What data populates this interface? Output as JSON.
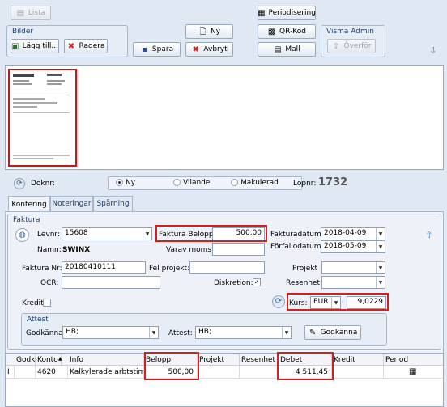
{
  "toolbar": {
    "lista": "Lista",
    "bilder_group": "Bilder",
    "lagg_till": "Lägg till...",
    "radera": "Radera",
    "ny": "Ny",
    "spara": "Spara",
    "avbryt": "Avbryt",
    "periodisering": "Periodisering",
    "qr_kod": "QR-Kod",
    "mall": "Mall",
    "visma_group": "Visma Admin",
    "overfor": "Överför"
  },
  "status": {
    "doknr_label": "Doknr:",
    "radio_ny": "Ny",
    "radio_vilande": "Vilande",
    "radio_makulerad": "Makulerad",
    "lopnr_label": "Löpnr:",
    "lopnr_value": "1732"
  },
  "tabs": [
    "Kontering",
    "Noteringar",
    "Spårning"
  ],
  "faktura": {
    "group_title": "Faktura",
    "levnr_label": "Levnr:",
    "levnr_value": "15608",
    "namn_label": "Namn:",
    "namn_value": "SWINX",
    "belopp_label": "Faktura Belopp:",
    "belopp_value": "500,00",
    "varav_moms_label": "Varav moms:",
    "fakturadatum_label": "Fakturadatum:",
    "fakturadatum_value": "2018-04-09",
    "forfallodatum_label": "Förfallodatum:",
    "forfallodatum_value": "2018-05-09",
    "fakturanr_label": "Faktura Nr:",
    "fakturanr_value": "20180410111",
    "fel_projekt_label": "Fel projekt:",
    "projekt_label": "Projekt",
    "ocr_label": "OCR:",
    "diskretion_label": "Diskretion:",
    "resenhet_label": "Resenhet",
    "kredit_label": "Kredit",
    "kurs_label": "Kurs:",
    "kurs_currency": "EUR",
    "kurs_value": "9,0229"
  },
  "attest": {
    "group_title": "Attest",
    "godkanna_label": "Godkänna:",
    "godkanna_value": "HB;",
    "attest_label": "Attest:",
    "attest_value": "HB;",
    "godkanna_button": "Godkänna"
  },
  "grid": {
    "headers": [
      "Godk",
      "Konto",
      "Info",
      "Belopp",
      "Projekt",
      "Resenhet",
      "Debet",
      "Kredit",
      "Period"
    ],
    "row": {
      "marker": "I",
      "konto": "4620",
      "info": "Kalkylerade arbtstimmar",
      "belopp": "500,00",
      "debet": "4 511,45"
    }
  },
  "colors": {
    "highlight": "#d21f1f",
    "panel": "#dfe8f3"
  }
}
